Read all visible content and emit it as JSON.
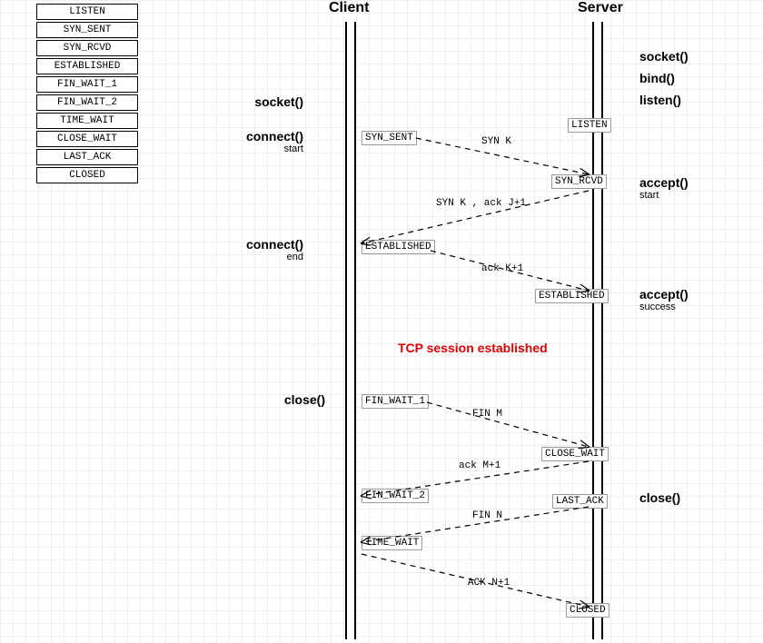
{
  "title_client": "Client",
  "title_server": "Server",
  "states_list": [
    "LISTEN",
    "SYN_SENT",
    "SYN_RCVD",
    "ESTABLISHED",
    "FIN_WAIT_1",
    "FIN_WAIT_2",
    "TIME_WAIT",
    "CLOSE_WAIT",
    "LAST_ACK",
    "CLOSED"
  ],
  "server_api": {
    "socket": "socket()",
    "bind": "bind()",
    "listen": "listen()",
    "accept_start": "accept()",
    "accept_start_sub": "start",
    "accept_ok": "accept()",
    "accept_ok_sub": "success",
    "close": "close()"
  },
  "client_api": {
    "socket": "socket()",
    "connect_start": "connect()",
    "connect_start_sub": "start",
    "connect_end": "connect()",
    "connect_end_sub": "end",
    "close": "close()"
  },
  "states": {
    "listen": "LISTEN",
    "syn_sent": "SYN_SENT",
    "syn_rcvd": "SYN_RCVD",
    "established_c": "ESTABLISHED",
    "established_s": "ESTABLISHED",
    "fin_wait_1": "FIN_WAIT_1",
    "close_wait": "CLOSE_WAIT",
    "fin_wait_2": "FIN_WAIT_2",
    "last_ack": "LAST_ACK",
    "time_wait": "TIME_WAIT",
    "closed": "CLOSED"
  },
  "msgs": {
    "syn_k": "SYN K",
    "syn_k_ack": "SYN K , ack J+1",
    "ack_k1": "ack K+1",
    "fin_m": "FIN M",
    "ack_m1": "ack M+1",
    "fin_n": "FIN N",
    "ack_n1": "ACK N+1"
  },
  "session": "TCP session established"
}
